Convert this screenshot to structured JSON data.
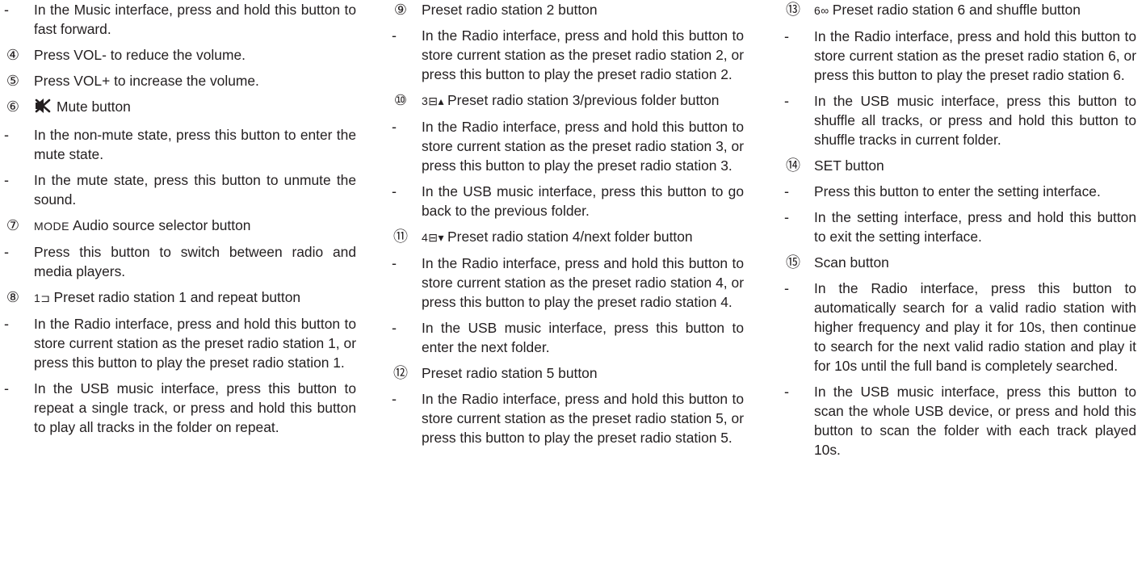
{
  "columns": [
    {
      "entries": [
        {
          "marker": "-",
          "text": "In the Music interface, press and hold this button to fast forward."
        },
        {
          "marker": "④",
          "text": "Press VOL- to reduce the volume."
        },
        {
          "marker": "⑤",
          "text": "Press VOL+ to increase the volume."
        },
        {
          "marker": "⑥",
          "icon": "mute-icon",
          "text": "Mute button"
        },
        {
          "marker": "-",
          "text": "In the non-mute state, press this button to enter the mute state."
        },
        {
          "marker": "-",
          "text": "In the mute state, press this button to unmute the sound."
        },
        {
          "marker": "⑦",
          "glyph": "MODE",
          "text": "Audio source selector button"
        },
        {
          "marker": "-",
          "text": "Press this button to switch between radio and media players."
        },
        {
          "marker": "⑧",
          "glyph": "1⊐",
          "text": "Preset radio station 1 and repeat button"
        },
        {
          "marker": "-",
          "text": "In the Radio interface, press and hold this button to store current station as the preset radio station 1, or press this button to play the preset radio station 1."
        },
        {
          "marker": "-",
          "text": "In the USB music interface, press this button to repeat a single track, or press and hold this button to play all tracks in the folder on repeat."
        }
      ]
    },
    {
      "entries": [
        {
          "marker": "⑨",
          "text": "Preset radio station 2 button"
        },
        {
          "marker": "-",
          "text": "In the Radio interface, press and hold this button to store current station as the preset radio station 2, or press this button to play the preset radio station 2."
        },
        {
          "marker": "⑩",
          "glyph": "3⊟▴",
          "text": "Preset radio station 3/previous folder button"
        },
        {
          "marker": "-",
          "text": "In the Radio interface, press and hold this button to store current station as the preset radio station 3, or press this button to play the preset radio station 3."
        },
        {
          "marker": "-",
          "text": "In the USB music interface, press this button to go back to the previous folder."
        },
        {
          "marker": "⑪",
          "glyph": "4⊟▾",
          "text": "Preset radio station 4/next folder button"
        },
        {
          "marker": "-",
          "text": "In the Radio interface, press and hold this button to store current station as the preset radio station 4, or press this button to play the preset radio station 4."
        },
        {
          "marker": "-",
          "text": "In the USB music interface, press this button to enter the next folder."
        },
        {
          "marker": "⑫",
          "text": "Preset radio station 5 button"
        },
        {
          "marker": "-",
          "text": "In the Radio interface, press and hold this button to store current station as the preset radio station 5, or press this button to play the preset radio station 5."
        }
      ]
    },
    {
      "entries": [
        {
          "marker": "⑬",
          "glyph": "6∞",
          "text": "Preset radio station 6 and shuffle button"
        },
        {
          "marker": "-",
          "text": "In the Radio interface, press and hold this button to store current station as the preset radio station 6, or press this button to play the preset radio station 6."
        },
        {
          "marker": "-",
          "text": "In the USB music interface, press this button to shuffle all tracks, or press and hold this button to shuffle tracks in current folder."
        },
        {
          "marker": "⑭",
          "text": "SET button"
        },
        {
          "marker": "-",
          "text": "Press this button to enter the setting interface."
        },
        {
          "marker": "-",
          "text": "In the setting interface, press and hold this button to exit the setting interface."
        },
        {
          "marker": "⑮",
          "text": "Scan button"
        },
        {
          "marker": "-",
          "text": "In the Radio interface, press this button to automatically search for a valid radio station with higher frequency and play it for 10s, then continue to search for the next valid radio station and play it for 10s until the full band is completely searched."
        },
        {
          "marker": "-",
          "text": "In the USB music interface, press this button to scan the whole USB device, or press and hold this button to scan the folder with each track played 10s."
        }
      ]
    }
  ]
}
